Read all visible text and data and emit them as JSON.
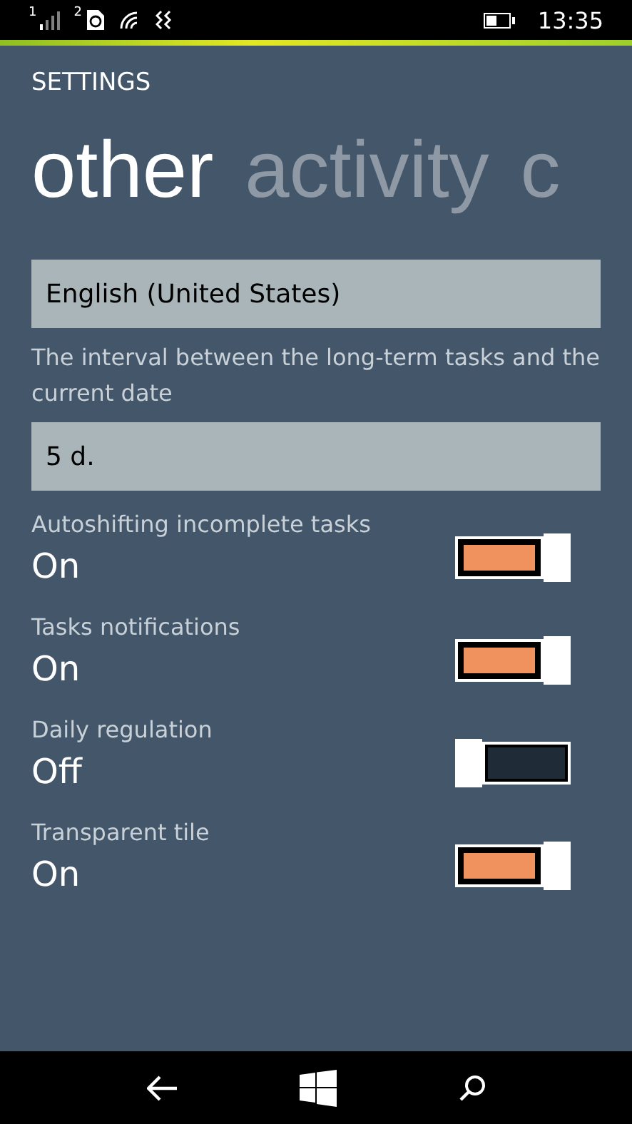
{
  "status_bar": {
    "sim_1": "1",
    "sim_2": "2",
    "time": "13:35"
  },
  "header": {
    "title": "SETTINGS"
  },
  "pivot": [
    {
      "label": "other",
      "selected": true
    },
    {
      "label": "activity",
      "selected": false
    },
    {
      "label": "c",
      "selected": false
    }
  ],
  "language": {
    "value": "English (United States)"
  },
  "interval": {
    "label": "The interval between the long-term tasks and the current date",
    "value": "5 d."
  },
  "toggles": [
    {
      "label": "Autoshifting incomplete tasks",
      "state": "On",
      "on": true
    },
    {
      "label": "Tasks notifications",
      "state": "On",
      "on": true
    },
    {
      "label": "Daily regulation",
      "state": "Off",
      "on": false
    },
    {
      "label": "Transparent tile",
      "state": "On",
      "on": true
    }
  ]
}
